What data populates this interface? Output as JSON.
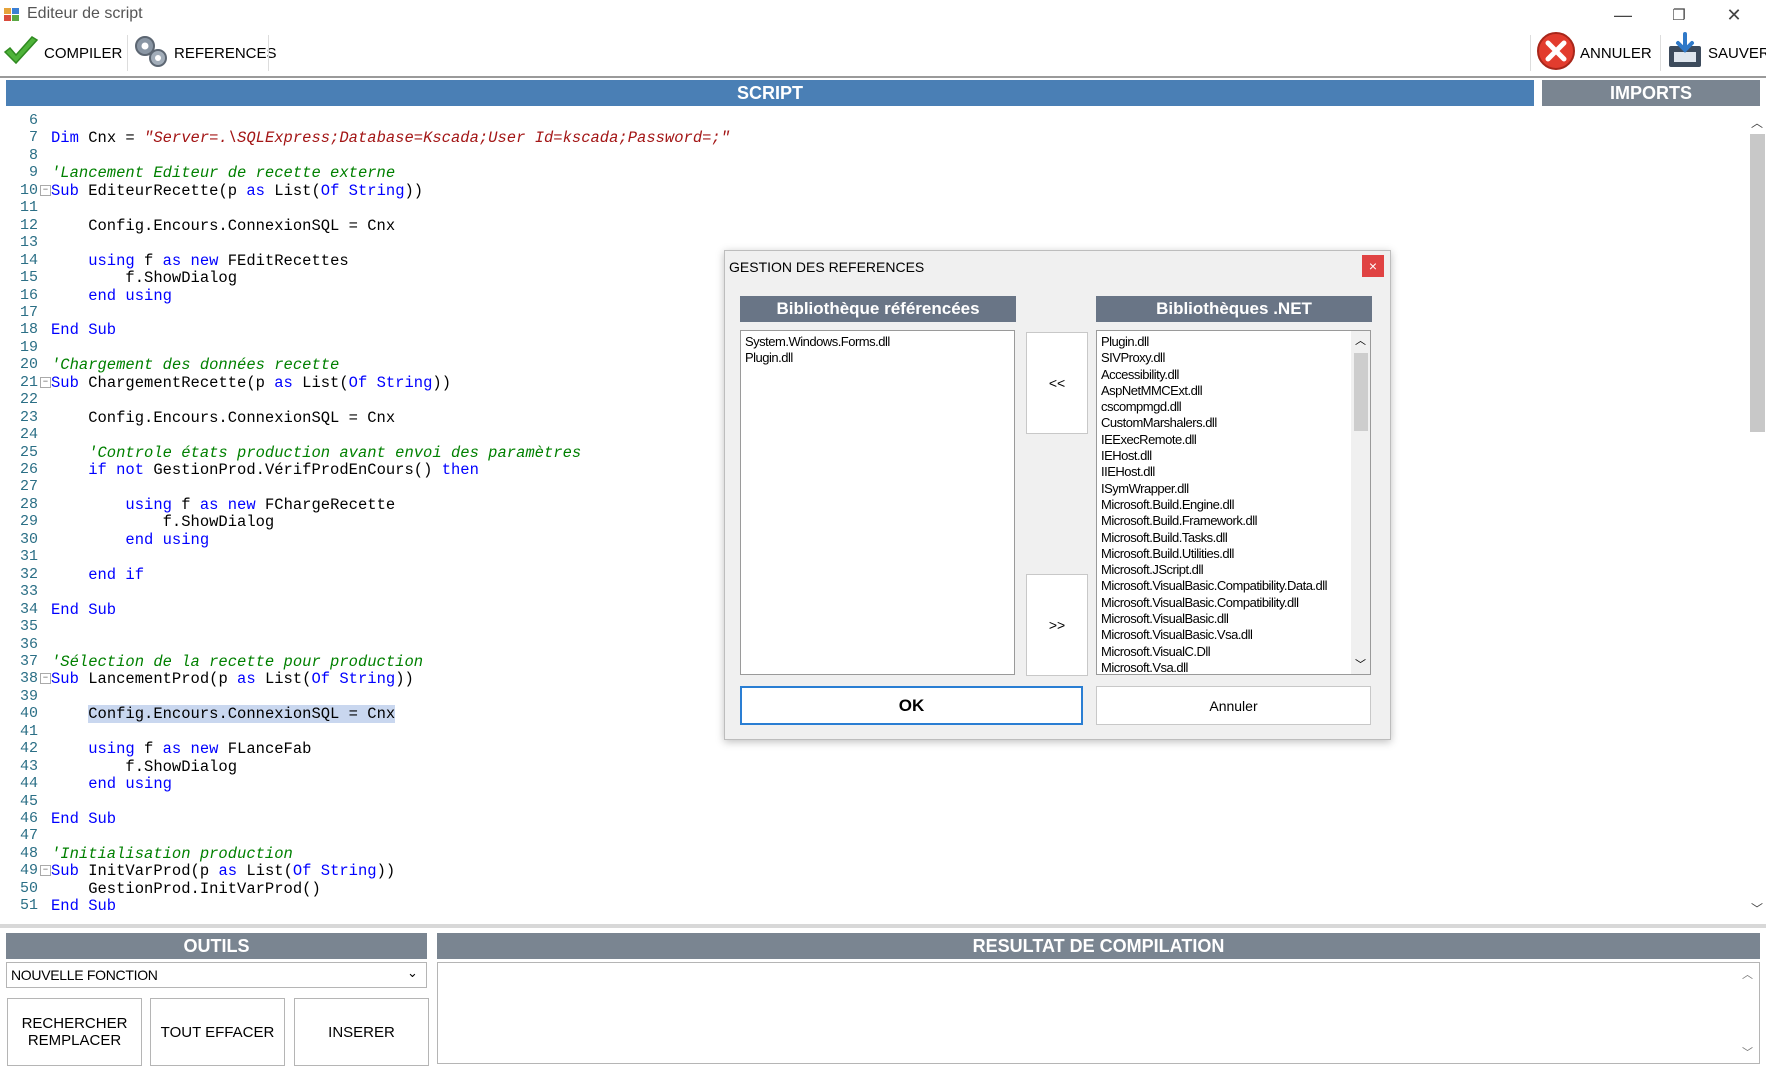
{
  "window": {
    "title": "Editeur de script",
    "minimize_glyph": "—",
    "restore_glyph": "❐",
    "close_glyph": "✕"
  },
  "toolbar": {
    "compile_label": "COMPILER",
    "references_label": "REFERENCES",
    "cancel_label": "ANNULER",
    "save_label": "SAUVER"
  },
  "tabs": {
    "script": "SCRIPT",
    "imports": "IMPORTS"
  },
  "editor": {
    "lines": [
      {
        "n": "6",
        "segs": []
      },
      {
        "n": "7",
        "segs": [
          {
            "t": "Dim ",
            "c": "kw"
          },
          {
            "t": "Cnx = ",
            "c": "tx"
          },
          {
            "t": "\"Server=.\\SQLExpress;Database=Kscada;User Id=kscada;Password=;\"",
            "c": "str"
          }
        ]
      },
      {
        "n": "8",
        "segs": []
      },
      {
        "n": "9",
        "segs": [
          {
            "t": "'Lancement Editeur de recette externe",
            "c": "cm"
          }
        ]
      },
      {
        "n": "10",
        "fold": true,
        "segs": [
          {
            "t": "Sub ",
            "c": "kw"
          },
          {
            "t": "EditeurRecette(p ",
            "c": "tx"
          },
          {
            "t": "as ",
            "c": "kw"
          },
          {
            "t": "List(",
            "c": "tx"
          },
          {
            "t": "Of String",
            "c": "kw"
          },
          {
            "t": "))",
            "c": "tx"
          }
        ]
      },
      {
        "n": "11",
        "segs": []
      },
      {
        "n": "12",
        "segs": [
          {
            "t": "    Config.Encours.ConnexionSQL = Cnx",
            "c": "tx"
          }
        ]
      },
      {
        "n": "13",
        "segs": []
      },
      {
        "n": "14",
        "segs": [
          {
            "t": "    using ",
            "c": "kw"
          },
          {
            "t": "f ",
            "c": "tx"
          },
          {
            "t": "as new ",
            "c": "kw"
          },
          {
            "t": "FEditRecettes",
            "c": "tx"
          }
        ]
      },
      {
        "n": "15",
        "segs": [
          {
            "t": "        f.ShowDialog",
            "c": "tx"
          }
        ]
      },
      {
        "n": "16",
        "segs": [
          {
            "t": "    end using",
            "c": "kw"
          }
        ]
      },
      {
        "n": "17",
        "segs": []
      },
      {
        "n": "18",
        "segs": [
          {
            "t": "End Sub",
            "c": "kw"
          }
        ]
      },
      {
        "n": "19",
        "segs": []
      },
      {
        "n": "20",
        "segs": [
          {
            "t": "'Chargement des données recette",
            "c": "cm"
          }
        ]
      },
      {
        "n": "21",
        "fold": true,
        "segs": [
          {
            "t": "Sub ",
            "c": "kw"
          },
          {
            "t": "ChargementRecette(p ",
            "c": "tx"
          },
          {
            "t": "as ",
            "c": "kw"
          },
          {
            "t": "List(",
            "c": "tx"
          },
          {
            "t": "Of String",
            "c": "kw"
          },
          {
            "t": "))",
            "c": "tx"
          }
        ]
      },
      {
        "n": "22",
        "segs": []
      },
      {
        "n": "23",
        "segs": [
          {
            "t": "    Config.Encours.ConnexionSQL = Cnx",
            "c": "tx"
          }
        ]
      },
      {
        "n": "24",
        "segs": []
      },
      {
        "n": "25",
        "segs": [
          {
            "t": "    'Controle états production avant envoi des paramètres",
            "c": "cm"
          }
        ]
      },
      {
        "n": "26",
        "segs": [
          {
            "t": "    if not ",
            "c": "kw"
          },
          {
            "t": "GestionProd.VérifProdEnCours() ",
            "c": "tx"
          },
          {
            "t": "then",
            "c": "kw"
          }
        ]
      },
      {
        "n": "27",
        "segs": []
      },
      {
        "n": "28",
        "segs": [
          {
            "t": "        using ",
            "c": "kw"
          },
          {
            "t": "f ",
            "c": "tx"
          },
          {
            "t": "as new ",
            "c": "kw"
          },
          {
            "t": "FChargeRecette",
            "c": "tx"
          }
        ]
      },
      {
        "n": "29",
        "segs": [
          {
            "t": "            f.ShowDialog",
            "c": "tx"
          }
        ]
      },
      {
        "n": "30",
        "segs": [
          {
            "t": "        end using",
            "c": "kw"
          }
        ]
      },
      {
        "n": "31",
        "segs": []
      },
      {
        "n": "32",
        "segs": [
          {
            "t": "    end if",
            "c": "kw"
          }
        ]
      },
      {
        "n": "33",
        "segs": []
      },
      {
        "n": "34",
        "segs": [
          {
            "t": "End Sub",
            "c": "kw"
          }
        ]
      },
      {
        "n": "35",
        "segs": []
      },
      {
        "n": "36",
        "segs": []
      },
      {
        "n": "37",
        "segs": [
          {
            "t": "'Sélection de la recette pour production",
            "c": "cm"
          }
        ]
      },
      {
        "n": "38",
        "fold": true,
        "segs": [
          {
            "t": "Sub ",
            "c": "kw"
          },
          {
            "t": "LancementProd(p ",
            "c": "tx"
          },
          {
            "t": "as ",
            "c": "kw"
          },
          {
            "t": "List(",
            "c": "tx"
          },
          {
            "t": "Of String",
            "c": "kw"
          },
          {
            "t": "))",
            "c": "tx"
          }
        ]
      },
      {
        "n": "39",
        "segs": []
      },
      {
        "n": "40",
        "segs": [
          {
            "t": "    ",
            "c": "tx"
          },
          {
            "t": "Config.Encours.ConnexionSQL = Cnx",
            "c": "tx hl"
          }
        ]
      },
      {
        "n": "41",
        "segs": []
      },
      {
        "n": "42",
        "segs": [
          {
            "t": "    using ",
            "c": "kw"
          },
          {
            "t": "f ",
            "c": "tx"
          },
          {
            "t": "as new ",
            "c": "kw"
          },
          {
            "t": "FLanceFab",
            "c": "tx"
          }
        ]
      },
      {
        "n": "43",
        "segs": [
          {
            "t": "        f.ShowDialog",
            "c": "tx"
          }
        ]
      },
      {
        "n": "44",
        "segs": [
          {
            "t": "    end using",
            "c": "kw"
          }
        ]
      },
      {
        "n": "45",
        "segs": []
      },
      {
        "n": "46",
        "segs": [
          {
            "t": "End Sub",
            "c": "kw"
          }
        ]
      },
      {
        "n": "47",
        "segs": []
      },
      {
        "n": "48",
        "segs": [
          {
            "t": "'Initialisation production",
            "c": "cm"
          }
        ]
      },
      {
        "n": "49",
        "fold": true,
        "segs": [
          {
            "t": "Sub ",
            "c": "kw"
          },
          {
            "t": "InitVarProd(p ",
            "c": "tx"
          },
          {
            "t": "as ",
            "c": "kw"
          },
          {
            "t": "List(",
            "c": "tx"
          },
          {
            "t": "Of String",
            "c": "kw"
          },
          {
            "t": "))",
            "c": "tx"
          }
        ]
      },
      {
        "n": "50",
        "segs": [
          {
            "t": "    GestionProd.InitVarProd()",
            "c": "tx"
          }
        ]
      },
      {
        "n": "51",
        "segs": [
          {
            "t": "End Sub",
            "c": "kw"
          }
        ]
      }
    ]
  },
  "dialog": {
    "title": "GESTION DES REFERENCES",
    "close_glyph": "×",
    "referenced_header": "Bibliothèque référencées",
    "net_header": "Bibliothèques .NET",
    "referenced_items": [
      "System.Windows.Forms.dll",
      "Plugin.dll"
    ],
    "net_items": [
      "Plugin.dll",
      "SIVProxy.dll",
      "Accessibility.dll",
      "AspNetMMCExt.dll",
      "cscompmgd.dll",
      "CustomMarshalers.dll",
      "IEExecRemote.dll",
      "IEHost.dll",
      "IIEHost.dll",
      "ISymWrapper.dll",
      "Microsoft.Build.Engine.dll",
      "Microsoft.Build.Framework.dll",
      "Microsoft.Build.Tasks.dll",
      "Microsoft.Build.Utilities.dll",
      "Microsoft.JScript.dll",
      "Microsoft.VisualBasic.Compatibility.Data.dll",
      "Microsoft.VisualBasic.Compatibility.dll",
      "Microsoft.VisualBasic.dll",
      "Microsoft.VisualBasic.Vsa.dll",
      "Microsoft.VisualC.Dll",
      "Microsoft.Vsa.dll"
    ],
    "move_left_label": "<<",
    "move_right_label": ">>",
    "ok_label": "OK",
    "cancel_label": "Annuler"
  },
  "tools": {
    "header": "OUTILS",
    "function_select_value": "NOUVELLE FONCTION",
    "search_replace_line1": "RECHERCHER",
    "search_replace_line2": "REMPLACER",
    "clear_all_label": "TOUT EFFACER",
    "insert_label": "INSERER"
  },
  "compile_result": {
    "header": "RESULTAT DE COMPILATION",
    "content": ""
  },
  "colors": {
    "header_blue": "#4a7fb5",
    "header_grey": "#7a8591",
    "keyword": "#0000ff",
    "string": "#a31515",
    "comment": "#008000",
    "line_number": "#2b6f86",
    "selection": "#c9d7ef",
    "close_red": "#e04343"
  }
}
